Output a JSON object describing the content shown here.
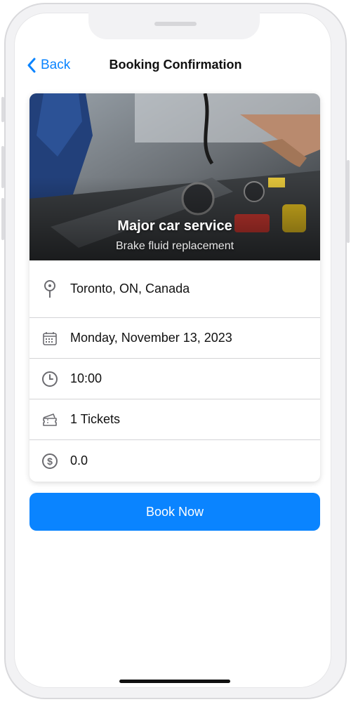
{
  "nav": {
    "back_label": "Back",
    "title": "Booking Confirmation"
  },
  "service": {
    "title": "Major car service",
    "subtitle": "Brake fluid replacement"
  },
  "details": {
    "location": {
      "icon": "map-pin-icon",
      "value": "Toronto, ON, Canada"
    },
    "date": {
      "icon": "calendar-icon",
      "value": "Monday, November 13, 2023"
    },
    "time": {
      "icon": "clock-icon",
      "value": "10:00"
    },
    "tickets": {
      "icon": "ticket-icon",
      "value": "1 Tickets"
    },
    "price": {
      "icon": "dollar-circle-icon",
      "value": "0.0"
    }
  },
  "actions": {
    "book_label": "Book Now"
  },
  "colors": {
    "accent": "#0a84ff",
    "icon_gray": "#6b6b70"
  }
}
